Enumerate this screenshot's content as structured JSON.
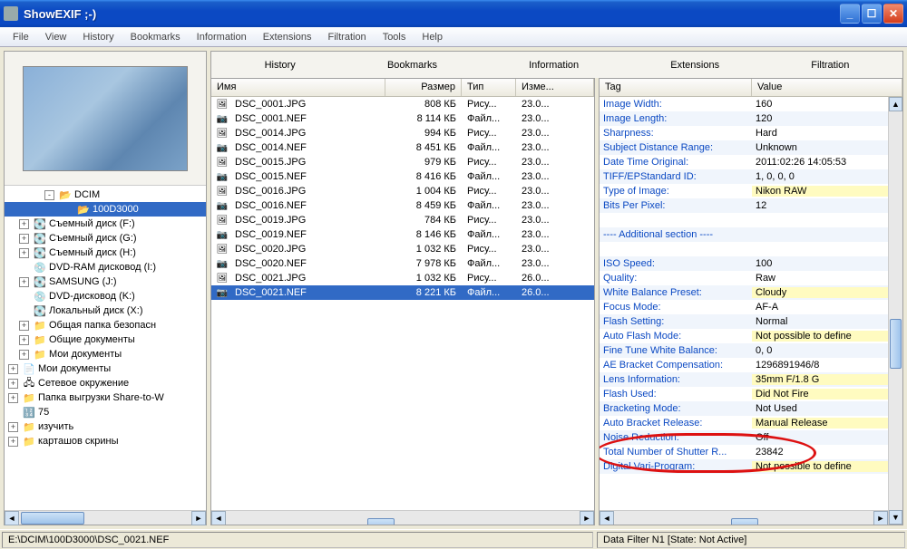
{
  "window": {
    "title": "ShowEXIF ;-)"
  },
  "menu": [
    "File",
    "View",
    "History",
    "Bookmarks",
    "Information",
    "Extensions",
    "Filtration",
    "Tools",
    "Help"
  ],
  "tabs": [
    "History",
    "Bookmarks",
    "Information",
    "Extensions",
    "Filtration"
  ],
  "tree": [
    {
      "indent": 40,
      "toggle": "-",
      "icon": "ico-folder-open",
      "label": "DCIM",
      "sel": false
    },
    {
      "indent": 60,
      "toggle": "",
      "icon": "ico-folder-open",
      "label": "100D3000",
      "sel": true
    },
    {
      "indent": 12,
      "toggle": "+",
      "icon": "ico-disk",
      "label": "Съемный диск (F:)",
      "sel": false
    },
    {
      "indent": 12,
      "toggle": "+",
      "icon": "ico-disk",
      "label": "Съемный диск (G:)",
      "sel": false
    },
    {
      "indent": 12,
      "toggle": "+",
      "icon": "ico-disk",
      "label": "Съемный диск (H:)",
      "sel": false
    },
    {
      "indent": 12,
      "toggle": "",
      "icon": "ico-cd",
      "label": "DVD-RAM дисковод (I:)",
      "sel": false
    },
    {
      "indent": 12,
      "toggle": "+",
      "icon": "ico-disk",
      "label": "SAMSUNG (J:)",
      "sel": false
    },
    {
      "indent": 12,
      "toggle": "",
      "icon": "ico-cd",
      "label": "DVD-дисковод (K:)",
      "sel": false
    },
    {
      "indent": 12,
      "toggle": "",
      "icon": "ico-disk",
      "label": "Локальный диск (X:)",
      "sel": false
    },
    {
      "indent": 12,
      "toggle": "+",
      "icon": "ico-folder",
      "label": "Общая папка безопасн",
      "sel": false
    },
    {
      "indent": 12,
      "toggle": "+",
      "icon": "ico-folder",
      "label": "Общие документы",
      "sel": false
    },
    {
      "indent": 12,
      "toggle": "+",
      "icon": "ico-folder",
      "label": "Мои документы",
      "sel": false
    },
    {
      "indent": 0,
      "toggle": "+",
      "icon": "ico-docs",
      "label": "Мои документы",
      "sel": false
    },
    {
      "indent": 0,
      "toggle": "+",
      "icon": "ico-net",
      "label": "Сетевое окружение",
      "sel": false
    },
    {
      "indent": 0,
      "toggle": "+",
      "icon": "ico-folder",
      "label": "Папка выгрузки Share-to-W",
      "sel": false
    },
    {
      "indent": 0,
      "toggle": "",
      "icon": "ico-num",
      "label": "75",
      "sel": false
    },
    {
      "indent": 0,
      "toggle": "+",
      "icon": "ico-folder",
      "label": "изучить",
      "sel": false
    },
    {
      "indent": 0,
      "toggle": "+",
      "icon": "ico-folder",
      "label": "карташов скрины",
      "sel": false
    }
  ],
  "file_cols": {
    "name": "Имя",
    "size": "Размер",
    "type": "Тип",
    "mod": "Изме..."
  },
  "files": [
    {
      "ico": "ico-jpg",
      "name": "DSC_0001.JPG",
      "size": "808 КБ",
      "type": "Рису...",
      "mod": "23.0..."
    },
    {
      "ico": "ico-nef",
      "name": "DSC_0001.NEF",
      "size": "8 114 КБ",
      "type": "Файл...",
      "mod": "23.0..."
    },
    {
      "ico": "ico-jpg",
      "name": "DSC_0014.JPG",
      "size": "994 КБ",
      "type": "Рису...",
      "mod": "23.0..."
    },
    {
      "ico": "ico-nef",
      "name": "DSC_0014.NEF",
      "size": "8 451 КБ",
      "type": "Файл...",
      "mod": "23.0..."
    },
    {
      "ico": "ico-jpg",
      "name": "DSC_0015.JPG",
      "size": "979 КБ",
      "type": "Рису...",
      "mod": "23.0..."
    },
    {
      "ico": "ico-nef",
      "name": "DSC_0015.NEF",
      "size": "8 416 КБ",
      "type": "Файл...",
      "mod": "23.0..."
    },
    {
      "ico": "ico-jpg",
      "name": "DSC_0016.JPG",
      "size": "1 004 КБ",
      "type": "Рису...",
      "mod": "23.0..."
    },
    {
      "ico": "ico-nef",
      "name": "DSC_0016.NEF",
      "size": "8 459 КБ",
      "type": "Файл...",
      "mod": "23.0..."
    },
    {
      "ico": "ico-jpg",
      "name": "DSC_0019.JPG",
      "size": "784 КБ",
      "type": "Рису...",
      "mod": "23.0..."
    },
    {
      "ico": "ico-nef",
      "name": "DSC_0019.NEF",
      "size": "8 146 КБ",
      "type": "Файл...",
      "mod": "23.0..."
    },
    {
      "ico": "ico-jpg",
      "name": "DSC_0020.JPG",
      "size": "1 032 КБ",
      "type": "Рису...",
      "mod": "23.0..."
    },
    {
      "ico": "ico-nef",
      "name": "DSC_0020.NEF",
      "size": "7 978 КБ",
      "type": "Файл...",
      "mod": "23.0..."
    },
    {
      "ico": "ico-jpg",
      "name": "DSC_0021.JPG",
      "size": "1 032 КБ",
      "type": "Рису...",
      "mod": "26.0..."
    },
    {
      "ico": "ico-nef",
      "name": "DSC_0021.NEF",
      "size": "8 221 КБ",
      "type": "Файл...",
      "mod": "26.0...",
      "sel": true
    }
  ],
  "exif_cols": {
    "tag": "Tag",
    "value": "Value"
  },
  "exif": [
    {
      "tag": "Image Width:",
      "val": "160"
    },
    {
      "tag": "Image Length:",
      "val": "120"
    },
    {
      "tag": "Sharpness:",
      "val": "Hard"
    },
    {
      "tag": "Subject Distance Range:",
      "val": "Unknown"
    },
    {
      "tag": "Date Time Original:",
      "val": "2011:02:26 14:05:53"
    },
    {
      "tag": "TIFF/EPStandard ID:",
      "val": "1, 0, 0, 0"
    },
    {
      "tag": "Type of Image:",
      "val": "Nikon RAW",
      "hl": true
    },
    {
      "tag": "Bits Per Pixel:",
      "val": "12"
    },
    {
      "tag": "",
      "val": ""
    },
    {
      "tag": "---- Additional section ----",
      "val": ""
    },
    {
      "tag": "",
      "val": ""
    },
    {
      "tag": "ISO Speed:",
      "val": "100"
    },
    {
      "tag": "Quality:",
      "val": "Raw"
    },
    {
      "tag": "White Balance Preset:",
      "val": "Cloudy",
      "hl": true
    },
    {
      "tag": "Focus Mode:",
      "val": "AF-A"
    },
    {
      "tag": "Flash Setting:",
      "val": "Normal"
    },
    {
      "tag": "Auto Flash Mode:",
      "val": "Not possible to define",
      "hl": true
    },
    {
      "tag": "Fine Tune White Balance:",
      "val": "0, 0"
    },
    {
      "tag": "AE Bracket Compensation:",
      "val": "1296891946/8"
    },
    {
      "tag": "Lens Information:",
      "val": "35mm  F/1.8 G",
      "hl": true
    },
    {
      "tag": "Flash Used:",
      "val": "Did Not Fire",
      "hl": true
    },
    {
      "tag": "Bracketing Mode:",
      "val": "Not Used"
    },
    {
      "tag": "Auto Bracket Release:",
      "val": "Manual Release",
      "hl": true
    },
    {
      "tag": "Noise Reduction:",
      "val": "Off"
    },
    {
      "tag": "Total Number of Shutter R...",
      "val": "23842"
    },
    {
      "tag": "Digital Vari-Program:",
      "val": "Not possible to define",
      "hl": true
    }
  ],
  "status": {
    "path": "E:\\DCIM\\100D3000\\DSC_0021.NEF",
    "filter": "Data Filter N1 [State: Not Active]"
  }
}
